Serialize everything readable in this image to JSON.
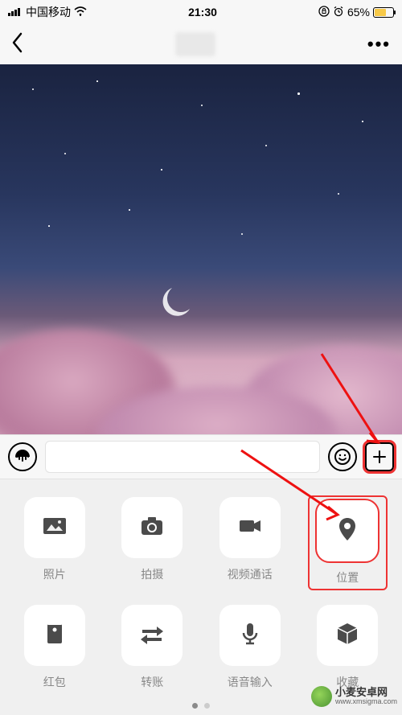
{
  "status": {
    "carrier": "中国移动",
    "wifi_icon": "wifi-icon",
    "time": "21:30",
    "lock_icon": "orientation-lock-icon",
    "alarm_icon": "alarm-icon",
    "battery_percent": "65%"
  },
  "nav": {
    "back_icon": "chevron-left-icon",
    "title_blurred": true,
    "more_label": "•••"
  },
  "chat": {
    "bg_desc": "night-sky-with-crescent-moon-and-pink-clouds"
  },
  "input_bar": {
    "voice_icon": "voice-wave-icon",
    "text_value": "",
    "text_placeholder": "",
    "emoji_icon": "smile-icon",
    "plus_icon": "plus-icon"
  },
  "attach": {
    "items": [
      {
        "label": "照片",
        "icon": "photo-icon",
        "highlighted": false
      },
      {
        "label": "拍摄",
        "icon": "camera-icon",
        "highlighted": false
      },
      {
        "label": "视频通话",
        "icon": "video-icon",
        "highlighted": false
      },
      {
        "label": "位置",
        "icon": "location-pin-icon",
        "highlighted": true
      },
      {
        "label": "红包",
        "icon": "red-envelope-icon",
        "highlighted": false
      },
      {
        "label": "转账",
        "icon": "transfer-icon",
        "highlighted": false
      },
      {
        "label": "语音输入",
        "icon": "mic-icon",
        "highlighted": false
      },
      {
        "label": "收藏",
        "icon": "cube-icon",
        "highlighted": false
      }
    ],
    "page_count": 2,
    "active_page": 0
  },
  "annotations": {
    "arrow_to_plus": true,
    "arrow_to_location": true,
    "plus_highlighted": true
  },
  "watermark": {
    "name": "小麦安卓网",
    "url": "www.xmsigma.com"
  },
  "colors": {
    "highlight": "#ee3333",
    "panel_bg": "#f0f0f0",
    "tile_bg": "#ffffff",
    "label": "#888888",
    "battery_fill": "#f7c948"
  }
}
